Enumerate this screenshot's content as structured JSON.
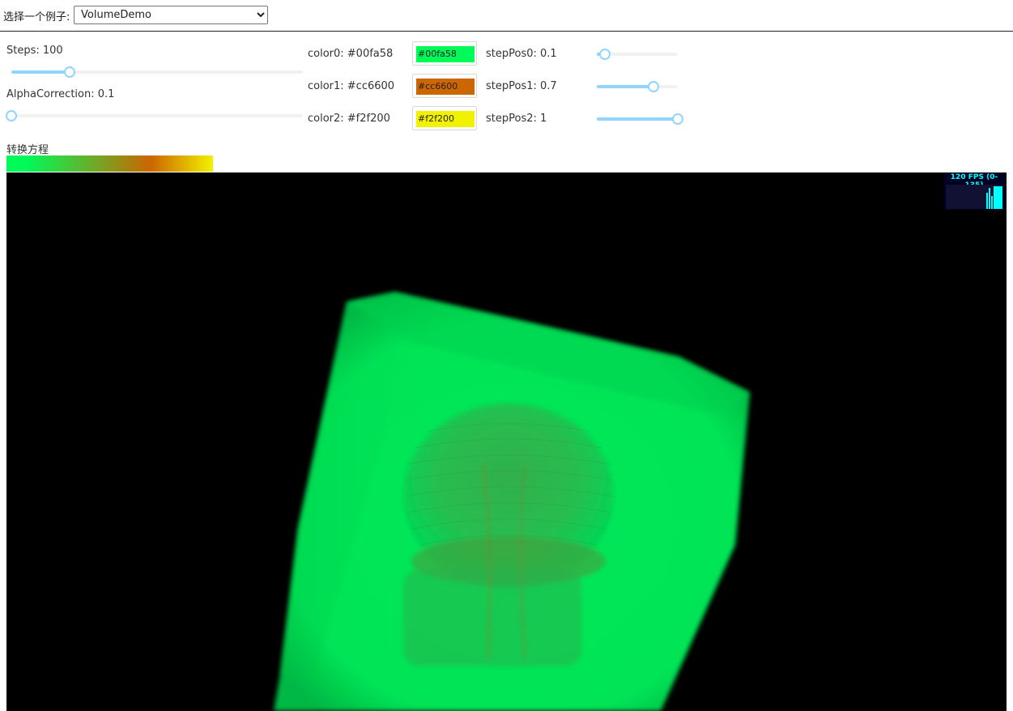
{
  "header": {
    "select_label": "选择一个例子:",
    "selected_example": "VolumeDemo"
  },
  "controls": {
    "steps": {
      "label": "Steps: 100",
      "value": 100,
      "fraction": 0.2
    },
    "alpha_correction": {
      "label": "AlphaCorrection: 0.1",
      "value": 0.1,
      "fraction": 0.0
    },
    "colors": [
      {
        "label": "color0: #00fa58",
        "value": "#00fa58"
      },
      {
        "label": "color1: #cc6600",
        "value": "#cc6600"
      },
      {
        "label": "color2: #f2f200",
        "value": "#f2f200"
      }
    ],
    "step_positions": [
      {
        "label": "stepPos0: 0.1",
        "value": 0.1
      },
      {
        "label": "stepPos1: 0.7",
        "value": 0.7
      },
      {
        "label": "stepPos2: 1",
        "value": 1
      }
    ],
    "slider_color": "#91d5ff"
  },
  "transfer": {
    "label": "转换方程"
  },
  "viewport": {
    "background": "#000000",
    "volume_color": "#00e855"
  },
  "stats": {
    "fps_text": "120 FPS (0-135)"
  }
}
